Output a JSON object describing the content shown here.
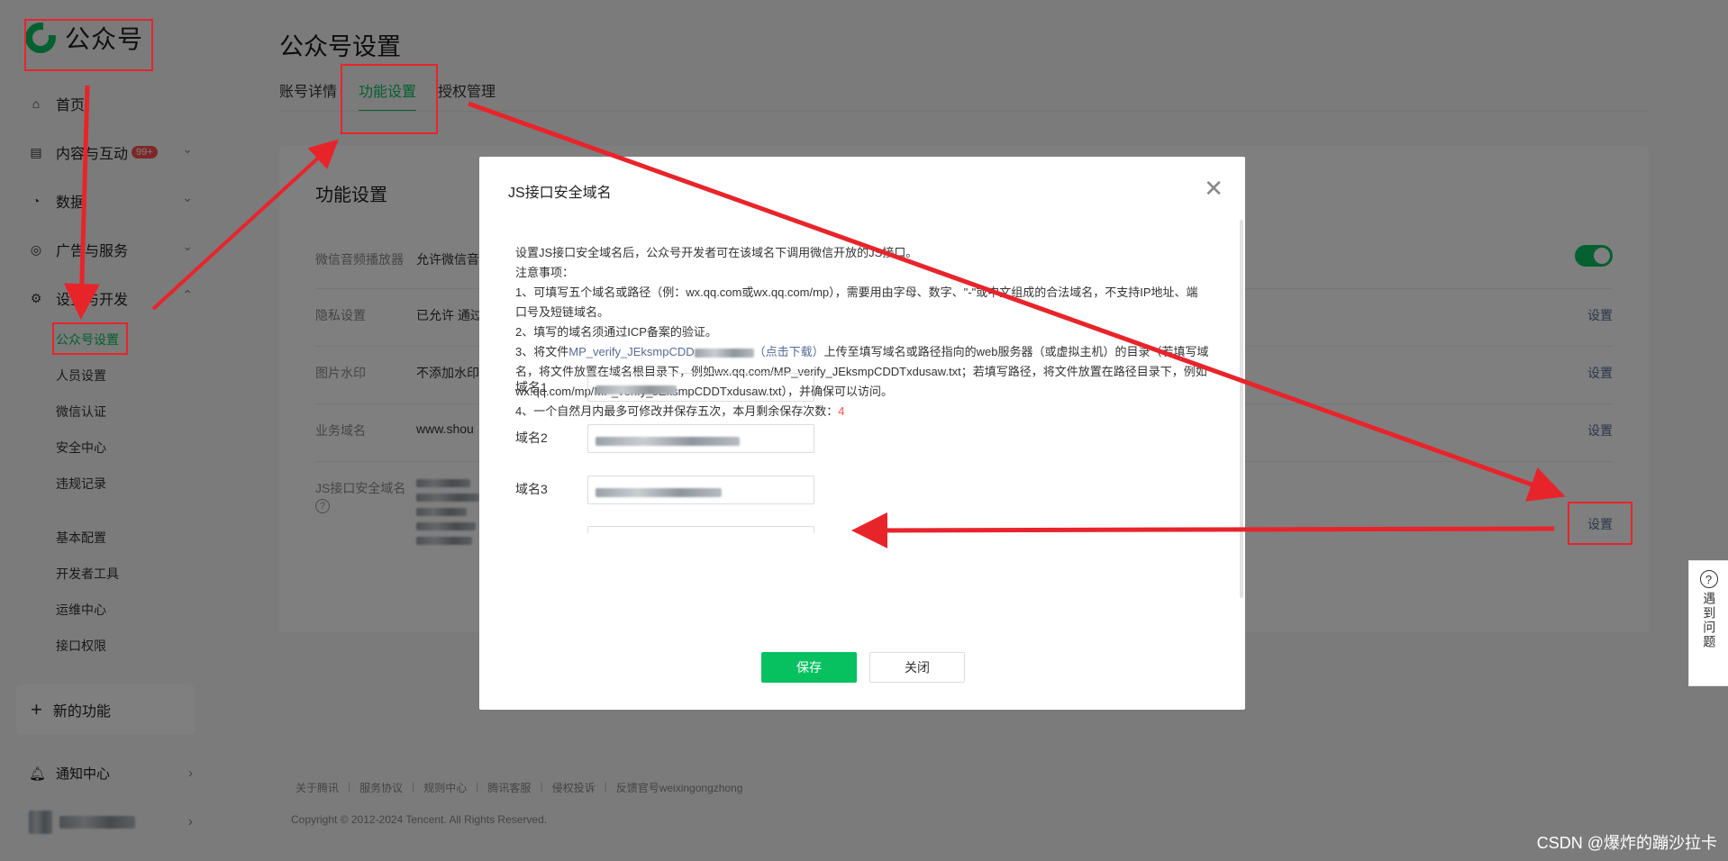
{
  "sidebar": {
    "logo_text": "公众号",
    "items": [
      {
        "label": "首页",
        "icon": "home-icon"
      },
      {
        "label": "内容与互动",
        "badge": "99+",
        "icon": "document-icon"
      },
      {
        "label": "数据",
        "icon": "pie-chart-icon"
      },
      {
        "label": "广告与服务",
        "icon": "compass-icon"
      },
      {
        "label": "设置与开发",
        "icon": "gear-icon"
      }
    ],
    "sub_items": [
      "公众号设置",
      "人员设置",
      "微信认证",
      "安全中心",
      "违规记录",
      "基本配置",
      "开发者工具",
      "运维中心",
      "接口权限"
    ],
    "new_feature": "新的功能",
    "notify": "通知中心"
  },
  "main": {
    "title": "公众号设置",
    "tabs": [
      "账号详情",
      "功能设置",
      "授权管理"
    ],
    "card_title": "功能设置",
    "rows": [
      {
        "label": "微信音频播放器",
        "value": "允许微信音"
      },
      {
        "label": "隐私设置",
        "value": "已允许 通过",
        "action": "设置"
      },
      {
        "label": "图片水印",
        "value": "不添加水印",
        "action": "设置"
      },
      {
        "label": "业务域名",
        "value": "www.shou",
        "action": "设置"
      },
      {
        "label": "JS接口安全域名",
        "action": "设置"
      }
    ]
  },
  "dialog": {
    "title": "JS接口安全域名",
    "intro": "设置JS接口安全域名后，公众号开发者可在该域名下调用微信开放的JS接口。",
    "notes_title": "注意事项：",
    "note1": "1、可填写五个域名或路径（例：wx.qq.com或wx.qq.com/mp），需要用由字母、数字、\"-\"或中文组成的合法域名，不支持IP地址、端口号及短链域名。",
    "note2": "2、填写的域名须通过ICP备案的验证。",
    "note3_a": "3、将文件",
    "note3_link": "MP_verify_JEksmpCDD",
    "note3_link2": "（点击下载）",
    "note3_b": "上传至填写域名或路径指向的web服务器（或虚拟主机）的目录（若填写域名，将文件放置在域名根目录下，例如wx.qq.com/MP_verify_JEksmpCDDTxdusaw.txt；若填写路径，将文件放置在路径目录下，例如wx.qq.com/mp/MP_verify_JEksmpCDDTxdusaw.txt），并确保可以访问。",
    "note4": "4、一个自然月内最多可修改并保存五次，本月剩余保存次数：",
    "note4_count": "4",
    "fields": [
      "域名1",
      "域名2",
      "域名3"
    ],
    "save": "保存",
    "close": "关闭"
  },
  "footer": {
    "links": [
      "关于腾讯",
      "服务协议",
      "规则中心",
      "腾讯客服",
      "侵权投诉",
      "反馈官号weixingongzhong"
    ],
    "copyright": "Copyright © 2012-2024 Tencent. All Rights Reserved."
  },
  "side_help": {
    "label": "遇到问题"
  },
  "watermark": "CSDN @爆炸的蹦沙拉卡",
  "colors": {
    "brand_green": "#07c160",
    "annotation_red": "#e8242b",
    "link_blue": "#576b95"
  }
}
